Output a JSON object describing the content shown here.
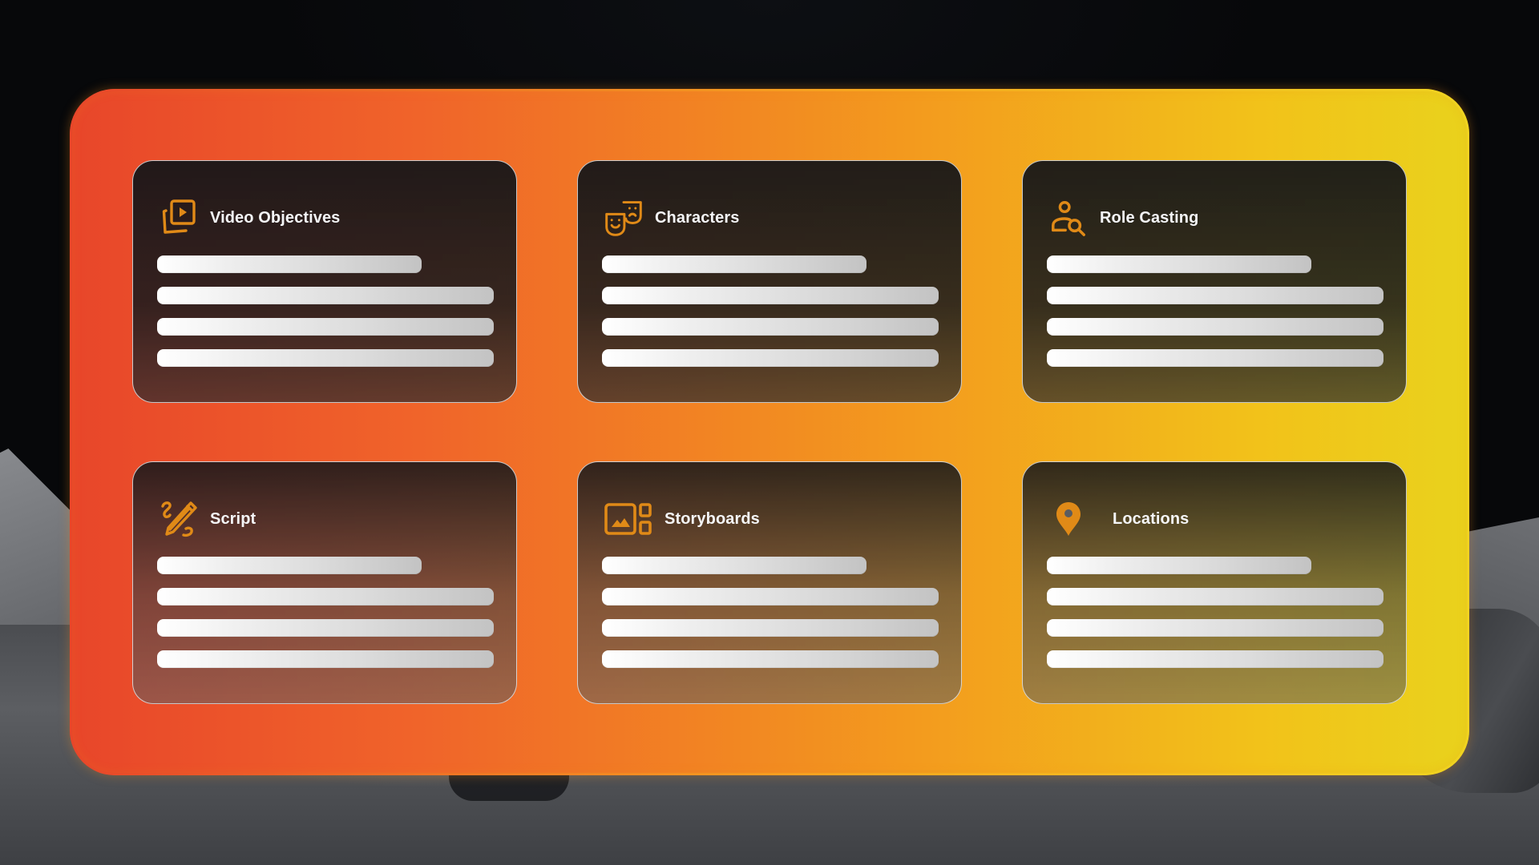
{
  "theme": {
    "accent": "#E08A17",
    "frame_gradient": [
      "#E8462A",
      "#F7A51F",
      "#F0D320"
    ],
    "card_border": "#E1E4E8",
    "title_color": "#F4F5F7",
    "placeholder_bar_colors": [
      "#FFFFFF",
      "#C3C3C3"
    ]
  },
  "background": {
    "scene": "lunar surface with astronaut and filmmaker"
  },
  "cards": [
    {
      "title": "Video Objectives",
      "icon": "video-play-stack-icon",
      "placeholder_lines": 4
    },
    {
      "title": "Characters",
      "icon": "theater-masks-icon",
      "placeholder_lines": 4
    },
    {
      "title": "Role Casting",
      "icon": "person-search-icon",
      "placeholder_lines": 4
    },
    {
      "title": "Script",
      "icon": "pencil-scribble-icon",
      "placeholder_lines": 4
    },
    {
      "title": "Storyboards",
      "icon": "image-grid-icon",
      "placeholder_lines": 4
    },
    {
      "title": "Locations",
      "icon": "map-pin-icon",
      "placeholder_lines": 4
    }
  ]
}
